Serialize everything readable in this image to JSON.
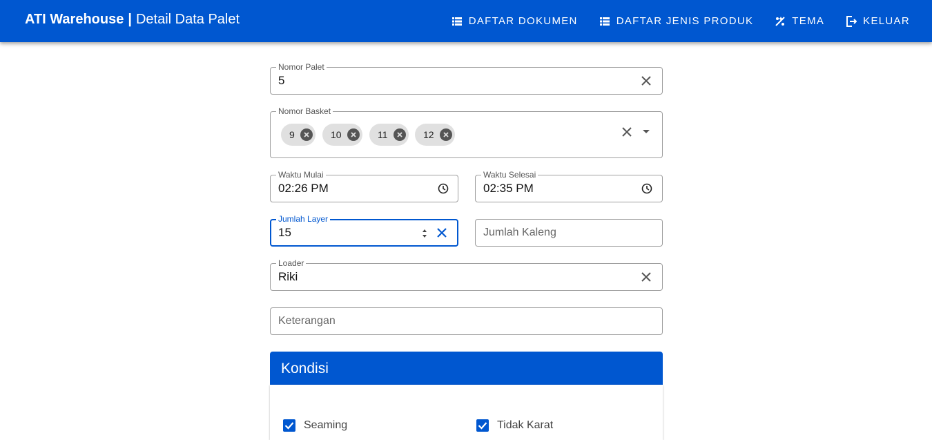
{
  "header": {
    "brand": "ATI Warehouse",
    "separator": "|",
    "page_title": "Detail Data Palet",
    "nav": [
      {
        "label": "DAFTAR DOKUMEN",
        "icon": "list-icon"
      },
      {
        "label": "DAFTAR JENIS PRODUK",
        "icon": "list-icon"
      },
      {
        "label": "TEMA",
        "icon": "theme-icon"
      },
      {
        "label": "KELUAR",
        "icon": "logout-icon"
      }
    ]
  },
  "form": {
    "nomor_palet": {
      "label": "Nomor Palet",
      "value": "5"
    },
    "nomor_basket": {
      "label": "Nomor Basket",
      "chips": [
        "9",
        "10",
        "11",
        "12"
      ]
    },
    "waktu_mulai": {
      "label": "Waktu Mulai",
      "value": "02:26 PM"
    },
    "waktu_selesai": {
      "label": "Waktu Selesai",
      "value": "02:35 PM"
    },
    "jumlah_layer": {
      "label": "Jumlah Layer",
      "value": "15"
    },
    "jumlah_kaleng": {
      "placeholder": "Jumlah Kaleng"
    },
    "loader": {
      "label": "Loader",
      "value": "Riki"
    },
    "keterangan": {
      "placeholder": "Keterangan"
    }
  },
  "kondisi": {
    "title": "Kondisi",
    "checkboxes": [
      {
        "label": "Seaming",
        "checked": true
      },
      {
        "label": "Tidak Karat",
        "checked": true
      }
    ]
  },
  "colors": {
    "primary": "#0057d0",
    "chip_bg": "#e0e0e0",
    "border": "#9e9e9e"
  }
}
